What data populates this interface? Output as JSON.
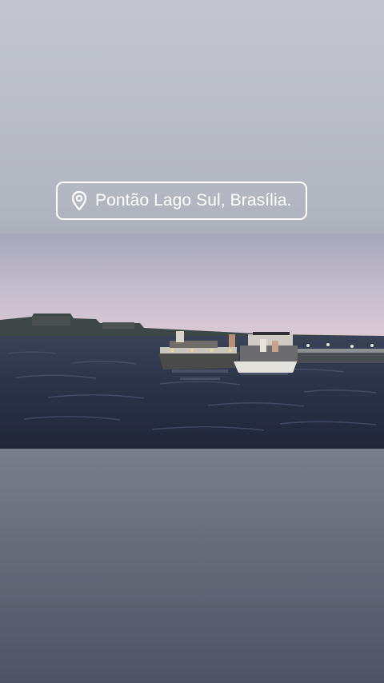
{
  "story": {
    "location_sticker": {
      "icon": "location-pin-icon",
      "text": "Pontão Lago Sul, Brasília."
    },
    "photo": {
      "subject": "lake-with-boats-at-dusk",
      "colors": {
        "sky_top": "#a9a9bd",
        "sky_horizon": "#d9c8d3",
        "water": "#2a3246"
      }
    }
  }
}
